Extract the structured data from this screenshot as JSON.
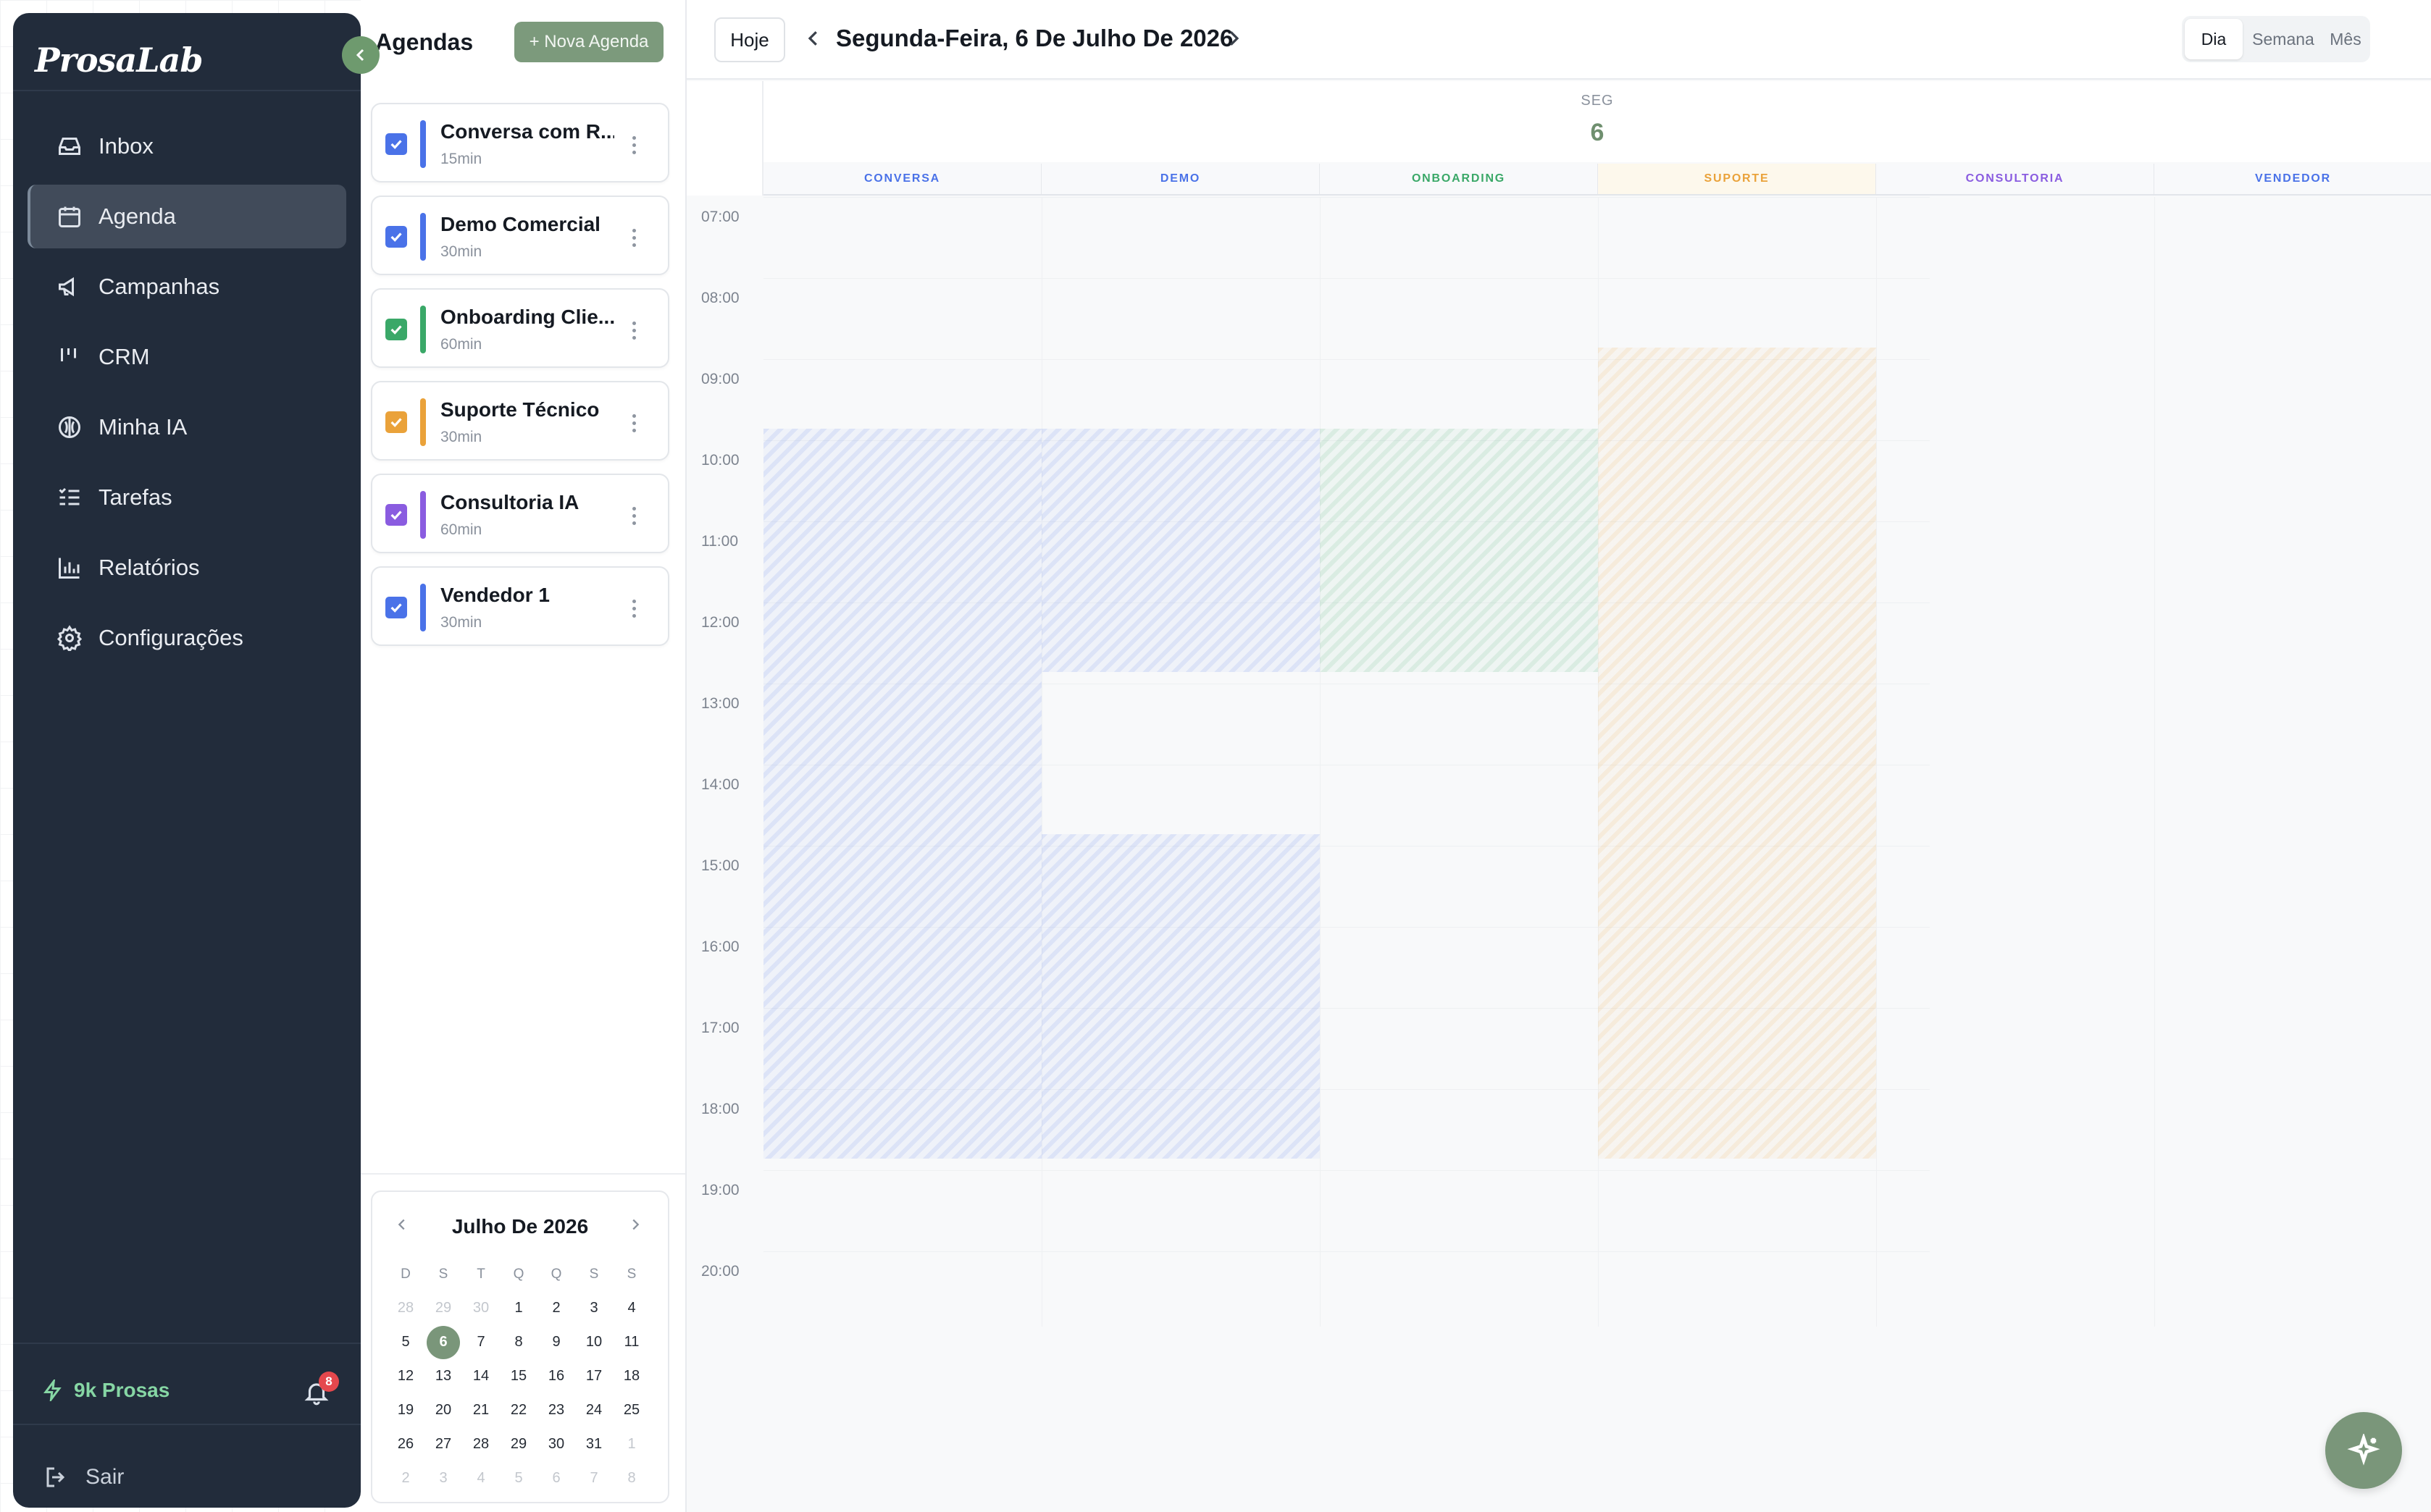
{
  "sidebar": {
    "logo": "ProsaLab",
    "items": [
      {
        "label": "Inbox",
        "icon": "inbox-icon"
      },
      {
        "label": "Agenda",
        "icon": "calendar-icon",
        "active": true
      },
      {
        "label": "Campanhas",
        "icon": "megaphone-icon"
      },
      {
        "label": "CRM",
        "icon": "kanban-icon"
      },
      {
        "label": "Minha IA",
        "icon": "brain-icon"
      },
      {
        "label": "Tarefas",
        "icon": "task-list-icon"
      },
      {
        "label": "Relatórios",
        "icon": "bar-chart-icon"
      },
      {
        "label": "Configurações",
        "icon": "gear-icon"
      }
    ],
    "credits": "9k Prosas",
    "notifications": "8",
    "logout": "Sair"
  },
  "agendas": {
    "title": "Agendas",
    "new_button": "+ Nova Agenda",
    "items": [
      {
        "name": "Conversa com R...",
        "duration": "15min",
        "color": "#4a72e8",
        "checked": true
      },
      {
        "name": "Demo Comercial",
        "duration": "30min",
        "color": "#4a72e8",
        "checked": true
      },
      {
        "name": "Onboarding Clie...",
        "duration": "60min",
        "color": "#3aa868",
        "checked": true
      },
      {
        "name": "Suporte Técnico",
        "duration": "30min",
        "color": "#eaa23a",
        "checked": true
      },
      {
        "name": "Consultoria IA",
        "duration": "60min",
        "color": "#8a5ce0",
        "checked": true
      },
      {
        "name": "Vendedor 1",
        "duration": "30min",
        "color": "#4a72e8",
        "checked": true
      }
    ]
  },
  "mini_calendar": {
    "title": "Julho De 2026",
    "weekdays": [
      "D",
      "S",
      "T",
      "Q",
      "Q",
      "S",
      "S"
    ],
    "days": [
      [
        "28",
        "29",
        "30",
        "1",
        "2",
        "3",
        "4"
      ],
      [
        "5",
        "6",
        "7",
        "8",
        "9",
        "10",
        "11"
      ],
      [
        "12",
        "13",
        "14",
        "15",
        "16",
        "17",
        "18"
      ],
      [
        "19",
        "20",
        "21",
        "22",
        "23",
        "24",
        "25"
      ],
      [
        "26",
        "27",
        "28",
        "29",
        "30",
        "31",
        "1"
      ],
      [
        "2",
        "3",
        "4",
        "5",
        "6",
        "7",
        "8"
      ]
    ],
    "today": "6"
  },
  "calendar": {
    "today_button": "Hoje",
    "date_title": "Segunda-Feira, 6 De Julho De 2026",
    "views": [
      "Dia",
      "Semana",
      "Mês"
    ],
    "active_view": "Dia",
    "day_of_week": "SEG",
    "day_number": "6",
    "columns": [
      {
        "label": "CONVERSA",
        "color": "#4a72e8"
      },
      {
        "label": "DEMO",
        "color": "#4a72e8"
      },
      {
        "label": "ONBOARDING",
        "color": "#3aa868"
      },
      {
        "label": "SUPORTE",
        "color": "#eaa23a"
      },
      {
        "label": "CONSULTORIA",
        "color": "#8a5ce0"
      },
      {
        "label": "VENDEDOR",
        "color": "#4a72e8"
      }
    ],
    "hours": [
      "07:00",
      "08:00",
      "09:00",
      "10:00",
      "11:00",
      "12:00",
      "13:00",
      "14:00",
      "15:00",
      "16:00",
      "17:00",
      "18:00",
      "19:00",
      "20:00"
    ],
    "availability": [
      {
        "column": 0,
        "ranges": [
          [
            "10:00",
            "19:00"
          ]
        ]
      },
      {
        "column": 1,
        "ranges": [
          [
            "10:00",
            "13:00"
          ],
          [
            "15:00",
            "19:00"
          ]
        ]
      },
      {
        "column": 2,
        "ranges": [
          [
            "10:00",
            "13:00"
          ]
        ]
      },
      {
        "column": 3,
        "ranges": [
          [
            "09:00",
            "19:00"
          ]
        ]
      }
    ]
  }
}
